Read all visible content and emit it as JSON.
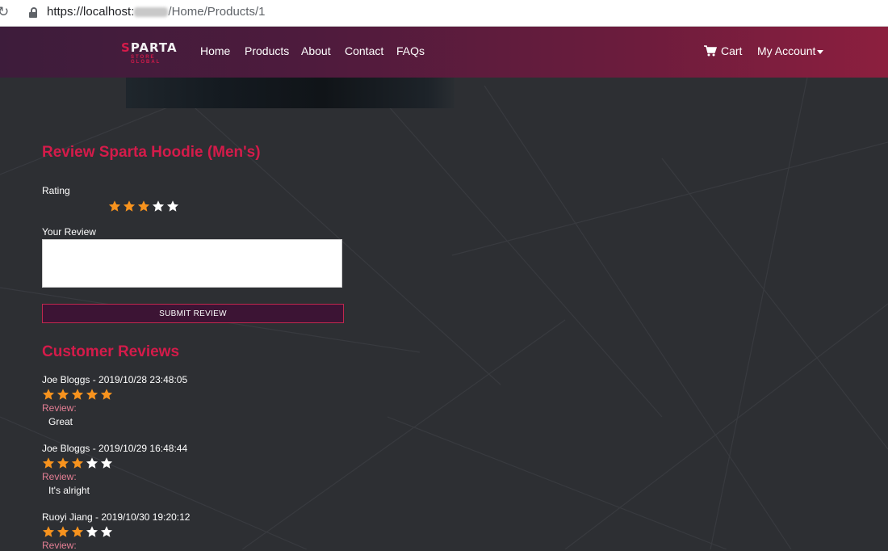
{
  "browser": {
    "url_prefix": "https://localhost:",
    "url_path": "/Home/Products/1"
  },
  "brand": {
    "logo_top_accent": "S",
    "logo_top_rest": "PARTA",
    "logo_bottom": "STORE GLOBAL"
  },
  "nav": {
    "home": "Home",
    "products": "Products",
    "about": "About",
    "contact": "Contact",
    "faqs": "FAQs",
    "cart": "Cart",
    "account": "My Account"
  },
  "colors": {
    "accent": "#d41b4a",
    "star_filled": "#f7931e",
    "star_empty": "#ffffff",
    "background": "#2d2f33"
  },
  "form": {
    "title": "Review Sparta Hoodie (Men's)",
    "rating_label": "Rating",
    "rating": 3,
    "rating_max": 5,
    "review_label": "Your Review",
    "review_value": "",
    "submit_label": "SUBMIT REVIEW"
  },
  "reviews": {
    "title": "Customer Reviews",
    "review_label": "Review:",
    "items": [
      {
        "author": "Joe Bloggs",
        "date": "2019/10/28 23:48:05",
        "heading": "Joe Bloggs - 2019/10/28 23:48:05",
        "rating": 5,
        "text": "Great"
      },
      {
        "author": "Joe Bloggs",
        "date": "2019/10/29 16:48:44",
        "heading": "Joe Bloggs - 2019/10/29 16:48:44",
        "rating": 3,
        "text": "It's alright"
      },
      {
        "author": "Ruoyi Jiang",
        "date": "2019/10/30 19:20:12",
        "heading": "Ruoyi Jiang - 2019/10/30 19:20:12",
        "rating": 3,
        "text": ""
      }
    ]
  }
}
